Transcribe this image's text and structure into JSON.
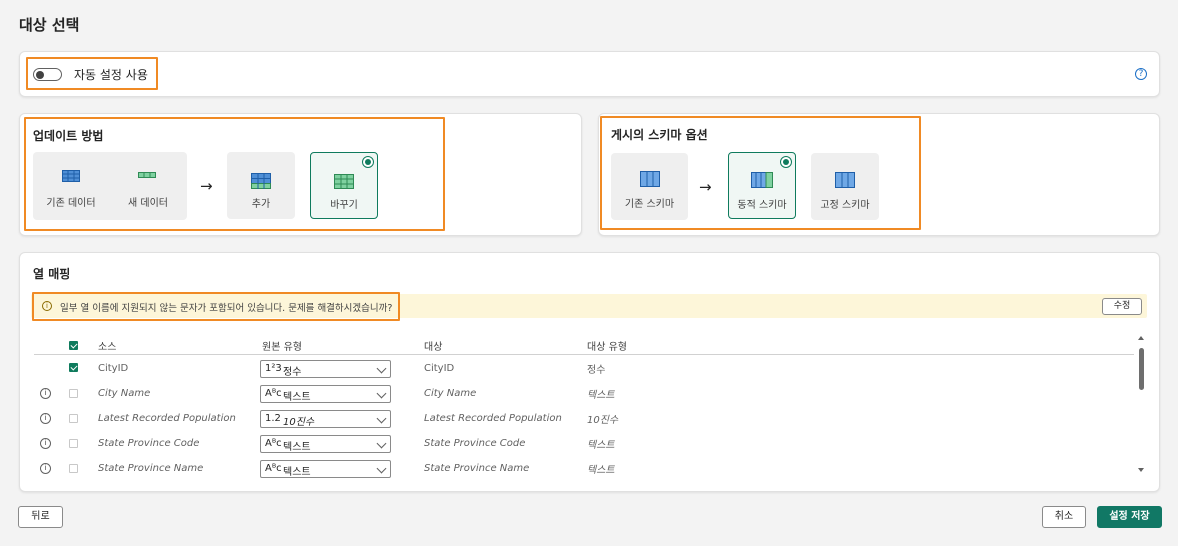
{
  "page": {
    "title": "대상 선택"
  },
  "auto_settings": {
    "label": "자동 설정 사용",
    "enabled": false,
    "help_icon": "question-circle-icon",
    "help_glyph": "?"
  },
  "update_method": {
    "title": "업데이트 방법",
    "existing_data": "기존 데이터",
    "new_data": "새 데이터",
    "arrow": "→",
    "options": [
      {
        "label": "추가",
        "selected": false
      },
      {
        "label": "바꾸기",
        "selected": true
      }
    ]
  },
  "schema_options": {
    "title": "게시의 스키마 옵션",
    "existing_schema": "기존 스키마",
    "arrow": "→",
    "options": [
      {
        "label": "동적 스키마",
        "selected": true
      },
      {
        "label": "고정 스키마",
        "selected": false
      }
    ]
  },
  "column_mapping": {
    "title": "열 매핑",
    "warning": {
      "icon": "info-circle-icon",
      "glyph": "i",
      "text": "일부 열 이름에 지원되지 않는 문자가 포함되어 있습니다. 문제를 해결하시겠습니까?",
      "fix_button": "수정"
    },
    "headers": {
      "source": "소스",
      "source_type": "원본 유형",
      "target": "대상",
      "target_type": "대상 유형"
    },
    "rows": [
      {
        "info": "",
        "checked": true,
        "source": "CityID",
        "type_icon": "1²3",
        "type": "정수",
        "target": "CityID",
        "target_type": "정수"
      },
      {
        "info": "i",
        "checked": false,
        "source": "City Name",
        "type_icon": "A͏ᴮc",
        "type": "텍스트",
        "target": "City Name",
        "target_type": "텍스트"
      },
      {
        "info": "i",
        "checked": false,
        "source": "Latest Recorded Population",
        "type_icon": "1.2",
        "type": "10진수",
        "target": "Latest Recorded Population",
        "target_type": "10진수"
      },
      {
        "info": "i",
        "checked": false,
        "source": "State Province Code",
        "type_icon": "A͏ᴮc",
        "type": "텍스트",
        "target": "State Province Code",
        "target_type": "텍스트"
      },
      {
        "info": "i",
        "checked": false,
        "source": "State Province Name",
        "type_icon": "A͏ᴮc",
        "type": "텍스트",
        "target": "State Province Name",
        "target_type": "텍스트"
      }
    ]
  },
  "footer": {
    "back": "뒤로",
    "cancel": "취소",
    "save": "설정 저장"
  }
}
